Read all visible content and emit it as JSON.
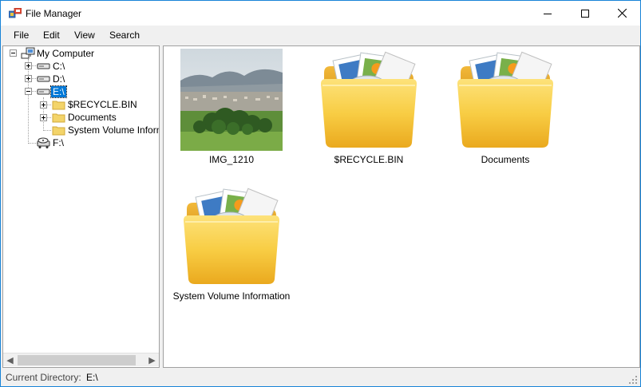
{
  "window": {
    "title": "File Manager"
  },
  "menu": {
    "items": [
      "File",
      "Edit",
      "View",
      "Search"
    ]
  },
  "tree": {
    "root": "My Computer",
    "drives": [
      "C:\\",
      "D:\\",
      "E:\\",
      "F:\\"
    ],
    "e_children": [
      "$RECYCLE.BIN",
      "Documents",
      "System Volume Informat"
    ]
  },
  "content": {
    "items": [
      {
        "name": "IMG_1210",
        "type": "image"
      },
      {
        "name": "$RECYCLE.BIN",
        "type": "folder"
      },
      {
        "name": "Documents",
        "type": "folder"
      },
      {
        "name": "System Volume Information",
        "type": "folder"
      }
    ]
  },
  "status": {
    "label": "Current Directory:",
    "value": "E:\\"
  },
  "colors": {
    "selection": "#0078d7",
    "folder": "#f6c53f",
    "window_border": "#1883d7"
  }
}
